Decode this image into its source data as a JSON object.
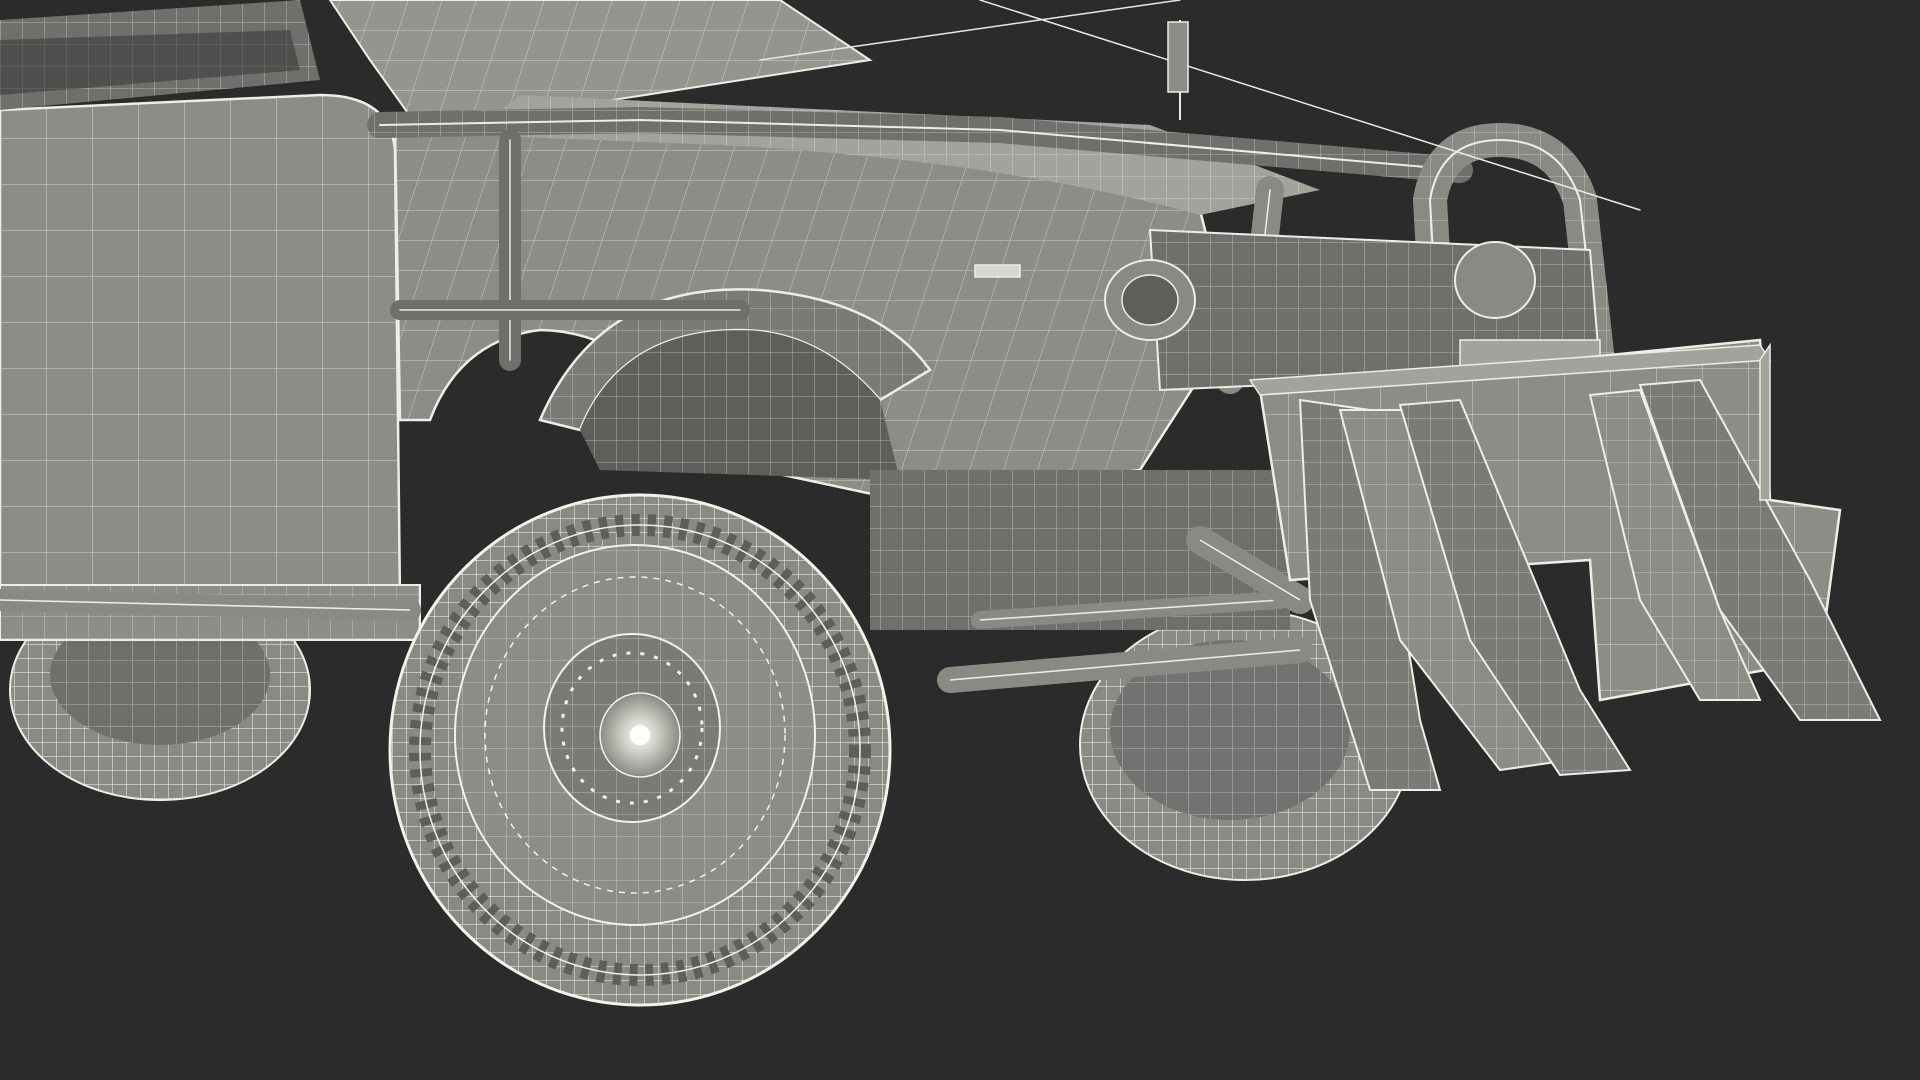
{
  "scene": {
    "subject": "wireframe-render-offroad-vehicle-front",
    "colors": {
      "background": "#2b2b2b",
      "body_fill": "#8d8d88",
      "body_fill_dark": "#6f6f6b",
      "body_fill_light": "#a3a39d",
      "wire": "#e9e9e2",
      "tire_fill": "#8a8a85",
      "tire_dark": "#5e5e5a"
    }
  }
}
